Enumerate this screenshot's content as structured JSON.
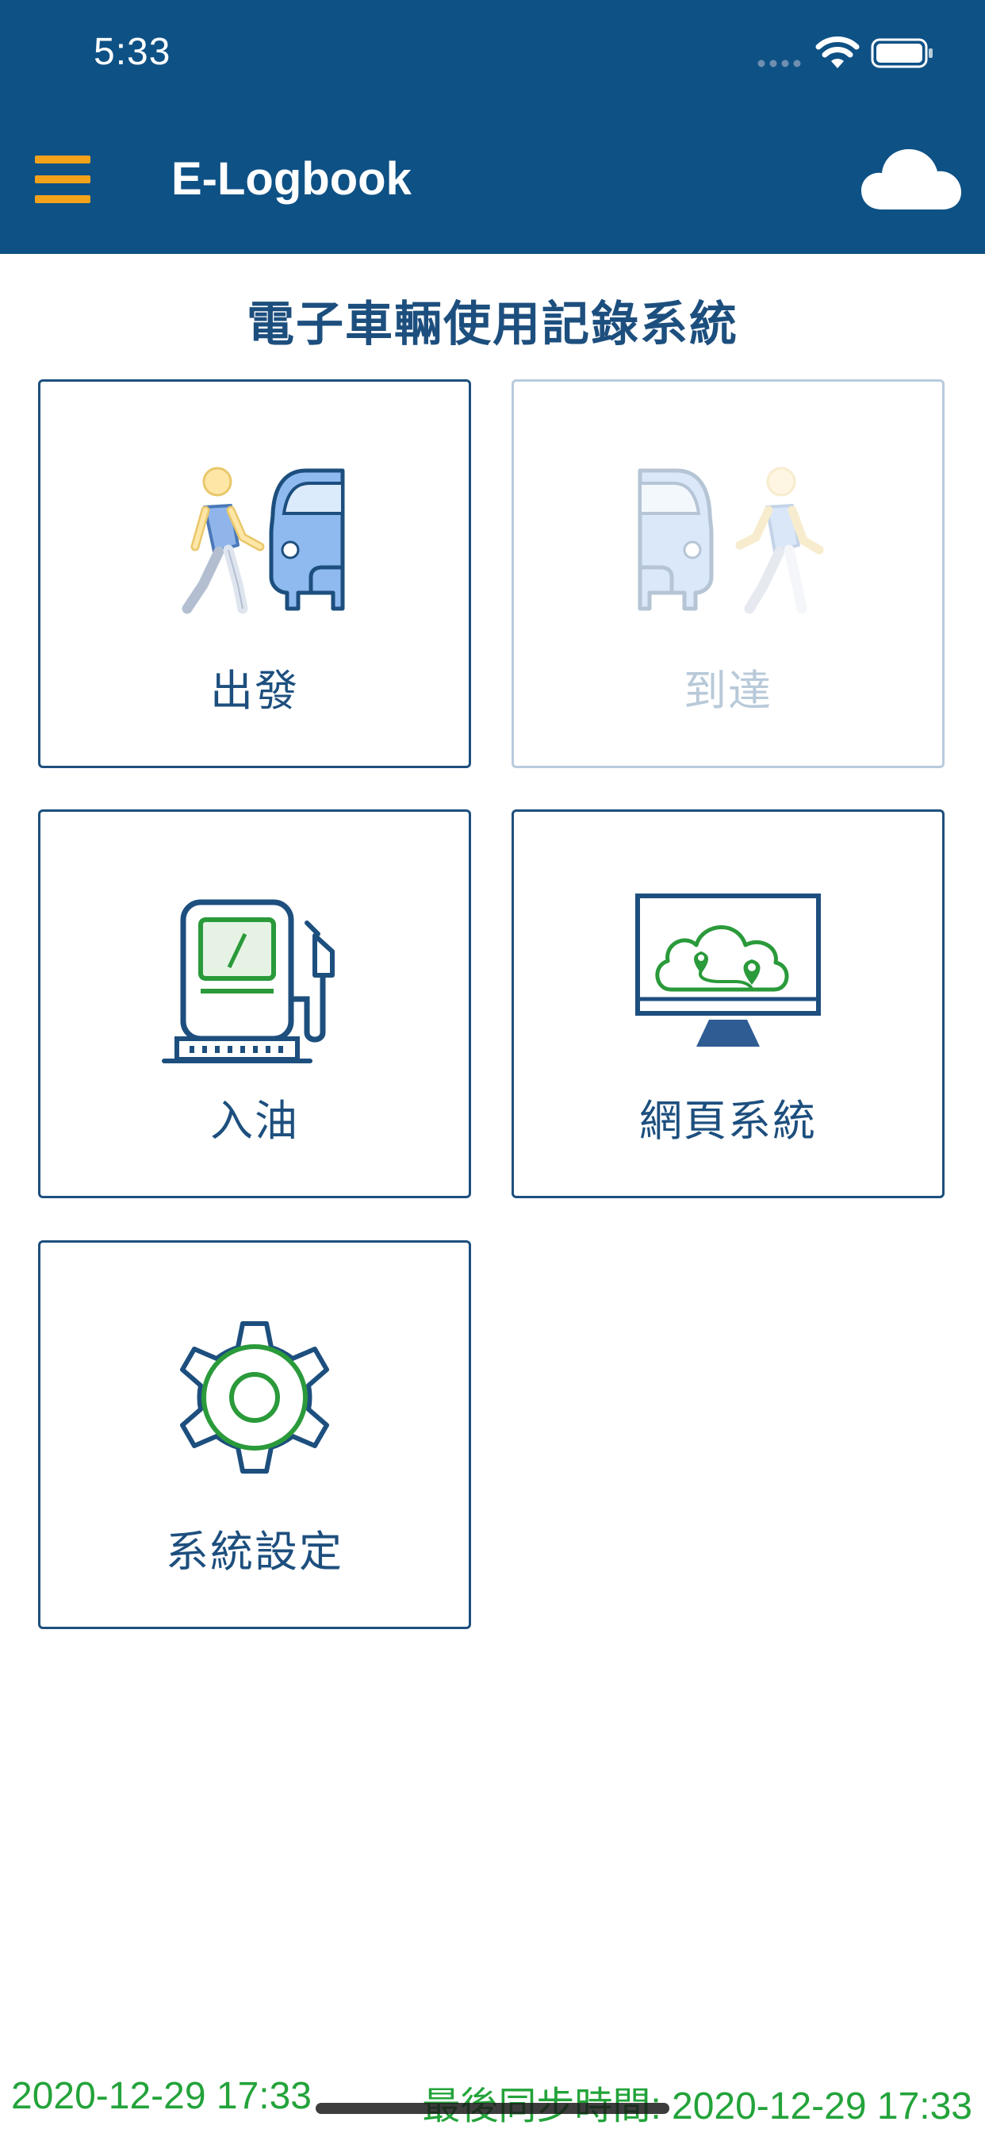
{
  "status_bar": {
    "time": "5:33"
  },
  "header": {
    "title": "E-Logbook",
    "menu_icon": "hamburger-menu-icon",
    "sync_icon": "cloud-icon",
    "background_color": "#0e5185",
    "accent_color": "#f5a21b"
  },
  "main": {
    "title": "電子車輛使用記錄系統",
    "tiles": [
      {
        "id": "depart",
        "label": "出發",
        "icon": "walk-to-car-icon",
        "enabled": true
      },
      {
        "id": "arrive",
        "label": "到達",
        "icon": "walk-from-car-icon",
        "enabled": false
      },
      {
        "id": "fuel",
        "label": "入油",
        "icon": "fuel-pump-icon",
        "enabled": true
      },
      {
        "id": "web",
        "label": "網頁系統",
        "icon": "web-monitor-map-icon",
        "enabled": true
      },
      {
        "id": "settings",
        "label": "系統設定",
        "icon": "gear-icon",
        "enabled": true
      }
    ]
  },
  "footer": {
    "left_timestamp": "2020-12-29 17:33",
    "sync_label": "最後同步時間: 2020-12-29 17:33",
    "text_color": "#23a33a"
  }
}
